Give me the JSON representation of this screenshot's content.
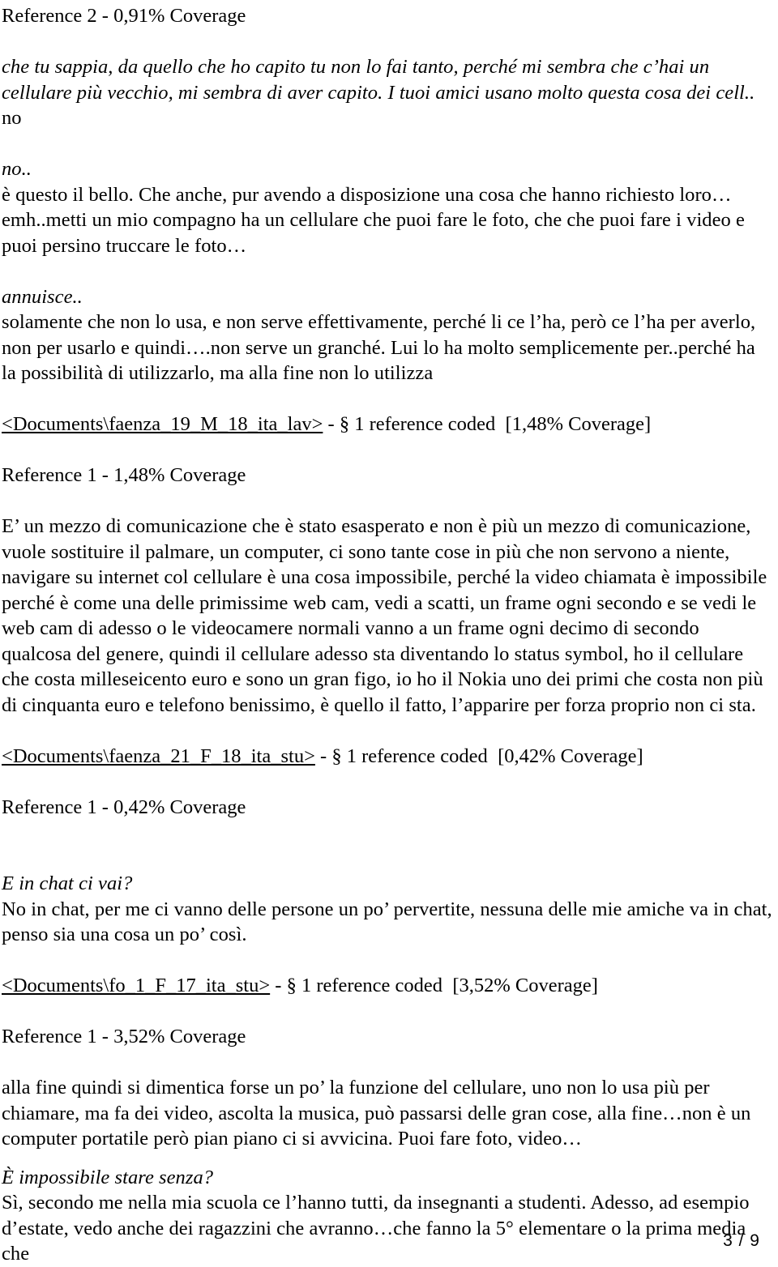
{
  "page": {
    "footer": "3 / 9",
    "number": 3,
    "total": 9
  },
  "blocks": [
    {
      "id": "reference-2-header",
      "kind": "reference-header",
      "style": "roman",
      "text": "Reference 2 - 0,91% Coverage"
    },
    {
      "id": "quote-1",
      "kind": "interview-question",
      "style": "italic",
      "text": "che tu sappia, da quello che ho capito tu non lo fai tanto, perché mi sembra che c’hai un cellulare più vecchio, mi sembra di aver capito. I tuoi amici usano molto questa cosa dei cell.."
    },
    {
      "id": "answer-1a",
      "kind": "interview-answer",
      "style": "roman",
      "text": "no"
    },
    {
      "id": "quote-2",
      "kind": "interview-question",
      "style": "italic",
      "text": "no.."
    },
    {
      "id": "answer-1b",
      "kind": "interview-answer",
      "style": "roman",
      "text": "è questo il bello. Che anche, pur avendo a disposizione una cosa che hanno richiesto loro…emh..metti un mio compagno ha un cellulare che puoi fare le foto, che che puoi fare i video e puoi persino truccare le foto…"
    },
    {
      "id": "quote-3",
      "kind": "interview-question",
      "style": "italic",
      "text": "annuisce.."
    },
    {
      "id": "answer-1c",
      "kind": "interview-answer",
      "style": "roman",
      "text": "solamente che non lo usa, e non serve effettivamente, perché li ce l’ha, però ce l’ha per averlo, non per usarlo e quindi….non serve un granché. Lui lo ha molto semplicemente per..perché ha la possibilità di utilizzarlo, ma alla fine non lo utilizza"
    }
  ],
  "documents": [
    {
      "id": "doc-faenza-19",
      "path": "<Documents\\faenza_19_M_18_ita_lav>",
      "separator": " - ",
      "section_symbol": "§",
      "reference_count_text": "1 reference coded",
      "coverage_text": "[1,48% Coverage]",
      "reference_header": "Reference 1 - 1,48% Coverage",
      "body": [
        {
          "id": "faenza19-body",
          "style": "roman",
          "text": "E’ un mezzo di comunicazione che è stato esasperato e non è più un mezzo di comunicazione, vuole sostituire il palmare, un computer, ci sono tante cose in più che non servono a niente, navigare su internet col cellulare è una cosa impossibile, perché la video chiamata è impossibile perché è come una delle primissime web cam, vedi a scatti, un frame ogni secondo e se vedi le web cam di adesso o le videocamere normali vanno a un frame ogni decimo di secondo qualcosa del genere, quindi il cellulare adesso sta diventando lo status symbol, ho il cellulare che costa milleseicento euro e sono un gran figo, io ho il Nokia uno dei primi che costa non più di cinquanta euro e telefono benissimo, è quello il fatto, l’apparire per forza proprio non ci sta."
        }
      ]
    },
    {
      "id": "doc-faenza-21",
      "path": "<Documents\\faenza_21_F_18_ita_stu>",
      "separator": " - ",
      "section_symbol": "§",
      "reference_count_text": "1 reference coded",
      "coverage_text": "[0,42% Coverage]",
      "reference_header": "Reference 1 - 0,42% Coverage",
      "body": [
        {
          "id": "faenza21-q",
          "style": "italic",
          "text": "E in chat ci vai?"
        },
        {
          "id": "faenza21-a",
          "style": "roman",
          "text": "No in chat, per me ci vanno delle persone un po’ pervertite, nessuna delle mie amiche va in chat, penso sia una cosa un po’ così."
        }
      ]
    },
    {
      "id": "doc-fo-1",
      "path": "<Documents\\fo_1_F_17_ita_stu>",
      "separator": " - ",
      "section_symbol": "§",
      "reference_count_text": "1 reference coded",
      "coverage_text": "[3,52% Coverage]",
      "reference_header": "Reference 1 - 3,52% Coverage",
      "body": [
        {
          "id": "fo1-a1",
          "style": "roman",
          "text": "alla fine quindi si dimentica forse un po’ la funzione del cellulare, uno non lo usa più per chiamare, ma fa dei video, ascolta la musica, può passarsi delle gran cose, alla fine…non è un computer portatile però pian piano ci si avvicina. Puoi fare foto, video…"
        },
        {
          "id": "fo1-q1",
          "style": "italic",
          "text": "È impossibile stare senza?"
        },
        {
          "id": "fo1-a2",
          "style": "roman",
          "text": "Sì, secondo me nella mia scuola ce l’hanno tutti, da insegnanti a studenti. Adesso, ad esempio d’estate, vedo anche dei ragazzini che avranno…che fanno la 5° elementare o la prima media che"
        }
      ]
    }
  ]
}
